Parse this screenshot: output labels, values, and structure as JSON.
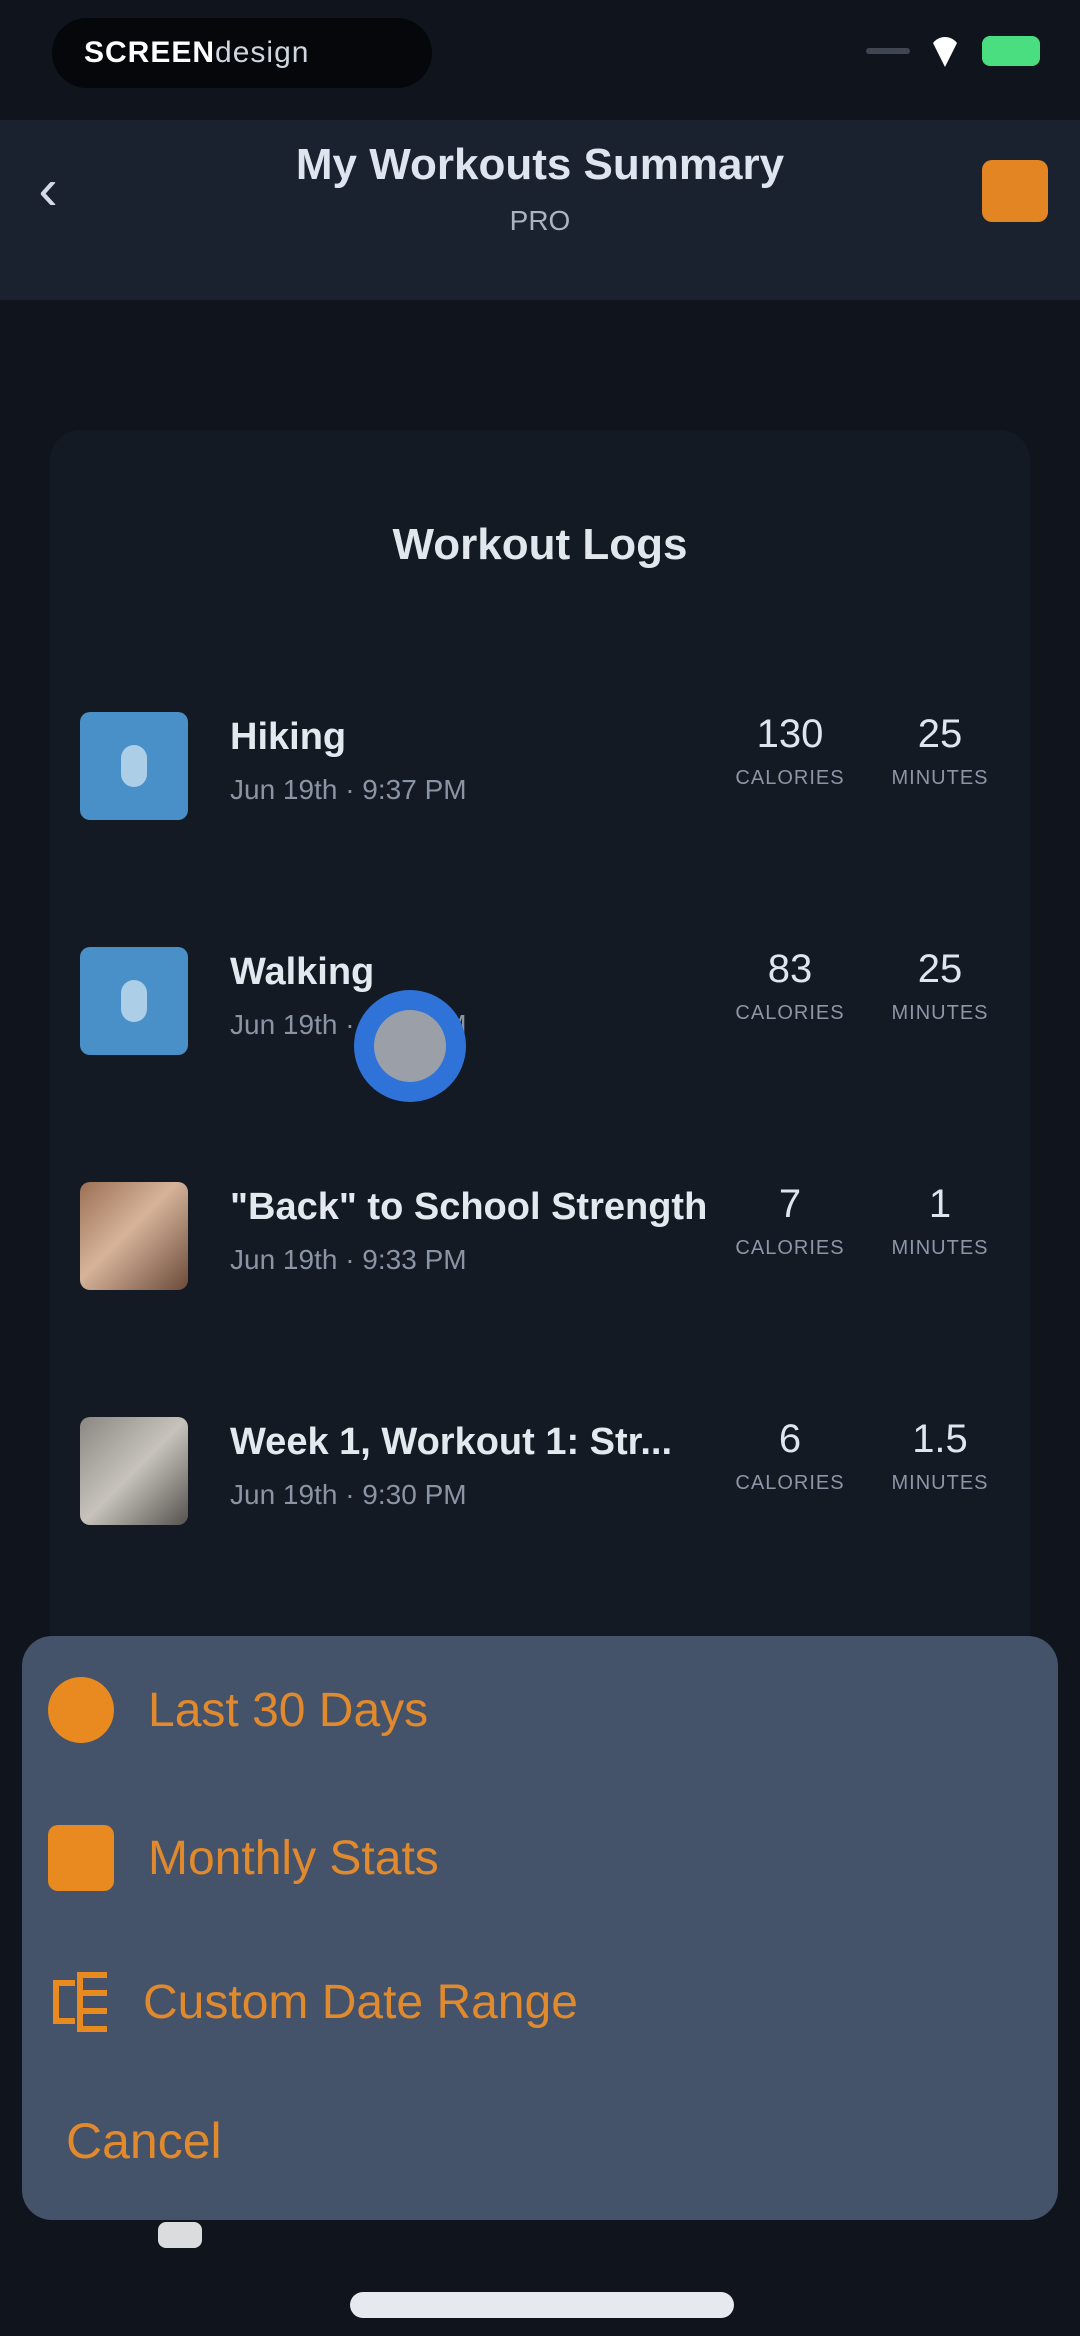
{
  "status_bar": {
    "pill_text_bold": "SCREEN",
    "pill_text_thin": "design"
  },
  "header": {
    "back_icon": "chevron-left-icon",
    "title": "My Workouts Summary",
    "subtitle": "PRO",
    "action_color": "#e38522"
  },
  "logs": {
    "title": "Workout Logs",
    "items": [
      {
        "name": "Hiking",
        "date": "Jun 19th · 9:37 PM",
        "calories": "130",
        "calories_label": "CALORIES",
        "minutes": "25",
        "minutes_label": "MINUTES",
        "thumb": "hiking-icon"
      },
      {
        "name": "Walking",
        "date": "Jun 19th · 9:35 PM",
        "calories": "83",
        "calories_label": "CALORIES",
        "minutes": "25",
        "minutes_label": "MINUTES",
        "thumb": "walking-icon"
      },
      {
        "name": "\"Back\" to School Strength",
        "date": "Jun 19th · 9:33 PM",
        "calories": "7",
        "calories_label": "CALORIES",
        "minutes": "1",
        "minutes_label": "MINUTES",
        "thumb": "workout-photo"
      },
      {
        "name": "Week 1, Workout 1: Str...",
        "date": "Jun 19th · 9:30 PM",
        "calories": "6",
        "calories_label": "CALORIES",
        "minutes": "1.5",
        "minutes_label": "MINUTES",
        "thumb": "workout-photo"
      }
    ]
  },
  "action_sheet": {
    "options": [
      {
        "label": "Last 30 Days",
        "icon": "dot-icon"
      },
      {
        "label": "Monthly Stats",
        "icon": "calendar-icon"
      },
      {
        "label": "Custom Date Range",
        "icon": "date-range-icon"
      }
    ],
    "cancel_label": "Cancel",
    "accent_color": "#e88a1f",
    "background_color": "#44536a"
  }
}
